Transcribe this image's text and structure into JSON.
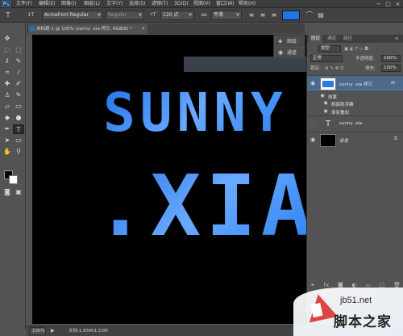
{
  "app": {
    "logo": "Ps"
  },
  "menu": [
    "文件(F)",
    "编辑(E)",
    "图像(I)",
    "图层(L)",
    "文字(Y)",
    "选择(S)",
    "滤镜(T)",
    "3D(D)",
    "视图(V)",
    "窗口(W)",
    "帮助(H)"
  ],
  "window_controls": [
    "−",
    "□",
    "×"
  ],
  "options": {
    "tool_icon": "T",
    "orient_icon": "↕T",
    "font_family": "AcmeFont Regular",
    "font_style": "Regular",
    "size_icon": "тT",
    "font_size": "120 点",
    "aa_icon": "aa",
    "aa_mode": "平滑",
    "color": "#1c77ef"
  },
  "document": {
    "tab_title": "未标题-1 @ 100% (sunny .xia 拷贝, RGB/8) *",
    "line1": "SUNNY",
    "line2": ".XIA"
  },
  "float_panel": {
    "layers_label": "图层",
    "channels_label": "通道"
  },
  "layers_panel": {
    "tabs": [
      "图层",
      "通道",
      "路径"
    ],
    "kind_label": "类型",
    "blend_mode": "正常",
    "opacity_label": "不透明度:",
    "opacity_value": "100%",
    "lock_label": "锁定:",
    "fill_label": "填充:",
    "fill_value": "100%",
    "layers": [
      {
        "name": "sunny .xia 拷贝",
        "fx": "fx",
        "thumb": "text",
        "selected": true
      },
      {
        "name": "效果",
        "type": "effects-header"
      },
      {
        "name": "斜面和浮雕",
        "type": "effect"
      },
      {
        "name": "渐变叠加",
        "type": "effect"
      },
      {
        "name": "sunny .xia",
        "thumb": "T"
      },
      {
        "name": "背景",
        "thumb": "black"
      }
    ]
  },
  "status": {
    "zoom": "100%",
    "doc_info": "文档:1.65M/1.53M"
  },
  "watermark": {
    "url": "jb51.net",
    "cn": "脚本之家"
  }
}
